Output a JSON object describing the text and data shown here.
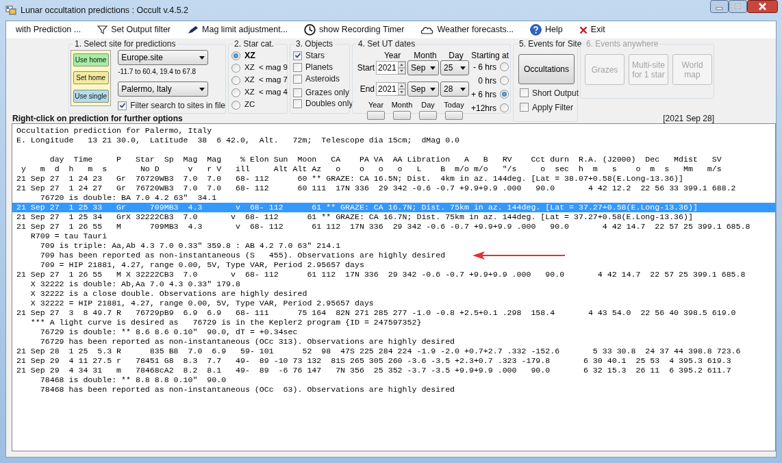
{
  "window": {
    "title": "Lunar occultation predictions : Occult v.4.5.2"
  },
  "menu": [
    {
      "label": "with Prediction ...",
      "kind": "plain"
    },
    {
      "label": "Set Output filter",
      "kind": "filter"
    },
    {
      "label": "Mag limit adjustment...",
      "kind": "magnitude"
    },
    {
      "label": "show Recording Timer",
      "kind": "timer"
    },
    {
      "label": "Weather forecasts...",
      "kind": "weather"
    },
    {
      "label": "Help",
      "kind": "help"
    },
    {
      "label": "Exit",
      "kind": "exit"
    }
  ],
  "site_group": {
    "title": "1.  Select site for predictions",
    "buttons": [
      {
        "label": "Use home",
        "color": "#a6eea6"
      },
      {
        "label": "Set home",
        "color": "#f3eba0"
      },
      {
        "label": "Use single",
        "color": "#b3dcea"
      }
    ],
    "site_file": "Europe.site",
    "range": "-11.7 to 60.4, 19.4 to 67.8",
    "site": "Palermo, Italy",
    "filter": {
      "label": "Filter search to sites in file",
      "checked": true
    }
  },
  "star_catalogue": {
    "title": "2. Star cat.",
    "options": [
      {
        "label": "XZ",
        "selected": true
      },
      {
        "label": "XZ  < mag 9",
        "selected": false
      },
      {
        "label": "XZ  < mag 7",
        "selected": false
      },
      {
        "label": "XZ  < mag 4",
        "selected": false
      },
      {
        "label": "ZC",
        "selected": false
      }
    ]
  },
  "objects": {
    "title": "3. Objects",
    "bodies": [
      {
        "label": "Stars",
        "checked": true
      },
      {
        "label": "Planets",
        "checked": false
      },
      {
        "label": "Asteroids",
        "checked": false
      }
    ],
    "limits": [
      {
        "label": "Grazes only",
        "checked": false
      },
      {
        "label": "Doubles only",
        "checked": false
      }
    ]
  },
  "dates": {
    "title": "4.  Set UT dates",
    "columns": [
      "Year",
      "Month",
      "Day"
    ],
    "rows": [
      {
        "label": "Start",
        "year": "2021",
        "month": "Sep",
        "day": "25"
      },
      {
        "label": "End",
        "year": "2021",
        "month": "Sep",
        "day": "28"
      }
    ],
    "starting_at": {
      "label": "Starting at",
      "options": [
        {
          "label": "- 6 hrs",
          "selected": false
        },
        {
          "label": "0 hrs",
          "selected": false
        },
        {
          "label": "+ 6 hrs",
          "selected": true
        },
        {
          "label": "+12hrs",
          "selected": false
        }
      ]
    },
    "quick_buttons": [
      "Year",
      "Month",
      "Day",
      "Today"
    ]
  },
  "site_events": {
    "title": "5. Events for Site",
    "button": "Occultations",
    "options": [
      {
        "label": "Short Output",
        "checked": false
      },
      {
        "label": "Apply Filter",
        "checked": false
      }
    ]
  },
  "anywhere_events": {
    "title": "6.  Events anywhere",
    "disabled": true,
    "buttons": [
      "Grazes",
      "Multi-site for 1 star",
      "World map"
    ]
  },
  "hint": "Right-click on prediction for further options",
  "date_range": "[2021 Sep 28]",
  "output": {
    "heading": [
      "Occultation prediction for Palermo, Italy",
      "E. Longitude   13 21 30.0,  Latitude  38  6 42.0,  Alt.   72m;  Telescope dia 15cm;  dMag 0.0"
    ],
    "column_headers": [
      "       day  Time     P   Star  Sp  Mag  Mag    % Elon Sun  Moon   CA    PA VA  AA Libration   A   B   RV    Cct durn  R.A. (J2000)  Dec   Mdist   SV",
      " y   m  d  h   m  s       No D      v   r V   ill     Alt Alt Az   o    o   o   o   L    B  m/o m/o   \"/s     o  sec  h  m   s    o  m  s   Mm   m/s"
    ],
    "lines": [
      {
        "text": "21 Sep 27  1 24 23   Gr  76720WB3  7.0  7.0   68- 112      60 ** GRAZE: CA 16.5N; Dist.  4km in az. 144deg. [Lat = 38.07+0.58(E.Long-13.36)]",
        "selected": false
      },
      {
        "text": "21 Sep 27  1 24 27   Gr  76720WB3  7.0  7.0   68- 112      60 111  17N 336  29 342 -0.6 -0.7 +9.9+9.9 .000   90.0       4 42 12.2  22 56 33 399.1 688.2",
        "selected": false
      },
      {
        "text": "     76720 is double: BA 7.0 4.2 63\"  34.1",
        "selected": false
      },
      {
        "text": "21 Sep 27  1 25 33   Gr     709MB3  4.3       v  68- 112      61 ** GRAZE: CA 16.7N; Dist. 75km in az. 144deg. [Lat = 37.27+0.58(E.Long-13.36)]",
        "selected": true
      },
      {
        "text": "21 Sep 27  1 25 34   GrX 32222CB3  7.0       v  68- 112      61 ** GRAZE: CA 16.7N; Dist. 75km in az. 144deg. [Lat = 37.27+0.58(E.Long-13.36)]",
        "selected": false
      },
      {
        "text": "21 Sep 27  1 26 55   M      709MB3  4.3       v  68- 112      61 112  17N 336  29 342 -0.6 -0.7 +9.9+9.9 .000   90.0       4 42 14.7  22 57 25 399.1 685.8",
        "selected": false
      },
      {
        "text": "   R709 = tau Tauri",
        "selected": false
      },
      {
        "text": "     709 is triple: Aa,Ab 4.3 7.0 0.33\" 359.8 : AB 4.2 7.0 63\" 214.1",
        "selected": false
      },
      {
        "text": "     709 has been reported as non-instantaneous (S   455). Observations are highly desired",
        "selected": false
      },
      {
        "text": "     709 = HIP 21881, 4.27, range 0.00, 5V, Type VAR, Period 2.95657 days",
        "selected": false
      },
      {
        "text": "21 Sep 27  1 26 55   M X 32222CB3  7.0       v  68- 112      61 112  17N 336  29 342 -0.6 -0.7 +9.9+9.9 .000   90.0       4 42 14.7  22 57 25 399.1 685.8",
        "selected": false
      },
      {
        "text": "   X 32222 is double: Ab,Aa 7.0 4.3 0.33\" 179.8",
        "selected": false
      },
      {
        "text": "   X 32222 is a close double. Observations are highly desired",
        "selected": false
      },
      {
        "text": "   X 32222 = HIP 21881, 4.27, range 0.00, 5V, Type VAR, Period 2.95657 days",
        "selected": false
      },
      {
        "text": "21 Sep 27  3  8 49.7 R   76729pB9  6.9  6.9   68- 111      75 164  82N 271 285 277 -1.0 -0.8 +2.5+0.1 .298  158.4       4 43 54.0  22 56 40 398.5 619.0",
        "selected": false
      },
      {
        "text": "   *** A light curve is desired as   76729 is in the Kepler2 program {ID = 247597352}",
        "selected": false
      },
      {
        "text": "     76729 is double: ** 8.6 8.6 0.10\"  90.0, dT = +0.34sec",
        "selected": false
      },
      {
        "text": "     76729 has been reported as non-instantaneous (OCc 313). Observations are highly desired",
        "selected": false
      },
      {
        "text": "21 Sep 28  1 25  5.3 R      835 B8  7.0  6.9   59- 101      52  98  47S 225 284 224 -1.9 -2.0 +0.7+2.7 .332 -152.6       5 33 30.8  24 37 44 398.8 723.6",
        "selected": false
      },
      {
        "text": "21 Sep 29  4 11 27.5 r   78451 G8  8.3  7.7   49-  89 -10 73 132  81S 265 305 260 -3.6 -3.5 +2.3+0.7 .323 -179.8       6 30 40.1  25 53  4 395.3 619.3",
        "selected": false
      },
      {
        "text": "21 Sep 29  4 34 31   m   78468cA2  8.2  8.1   49-  89  -6 76 147   7N 356  25 352 -3.7 -3.5 +9.9+9.9 .000   90.0       6 32 15.3  26 11  6 395.2 611.7",
        "selected": false
      },
      {
        "text": "     78468 is double: ** 8.8 8.8 0.10\"  90.0",
        "selected": false
      },
      {
        "text": "     78468 has been reported as non-instantaneous (OCc  63). Observations are highly desired",
        "selected": false
      }
    ]
  }
}
